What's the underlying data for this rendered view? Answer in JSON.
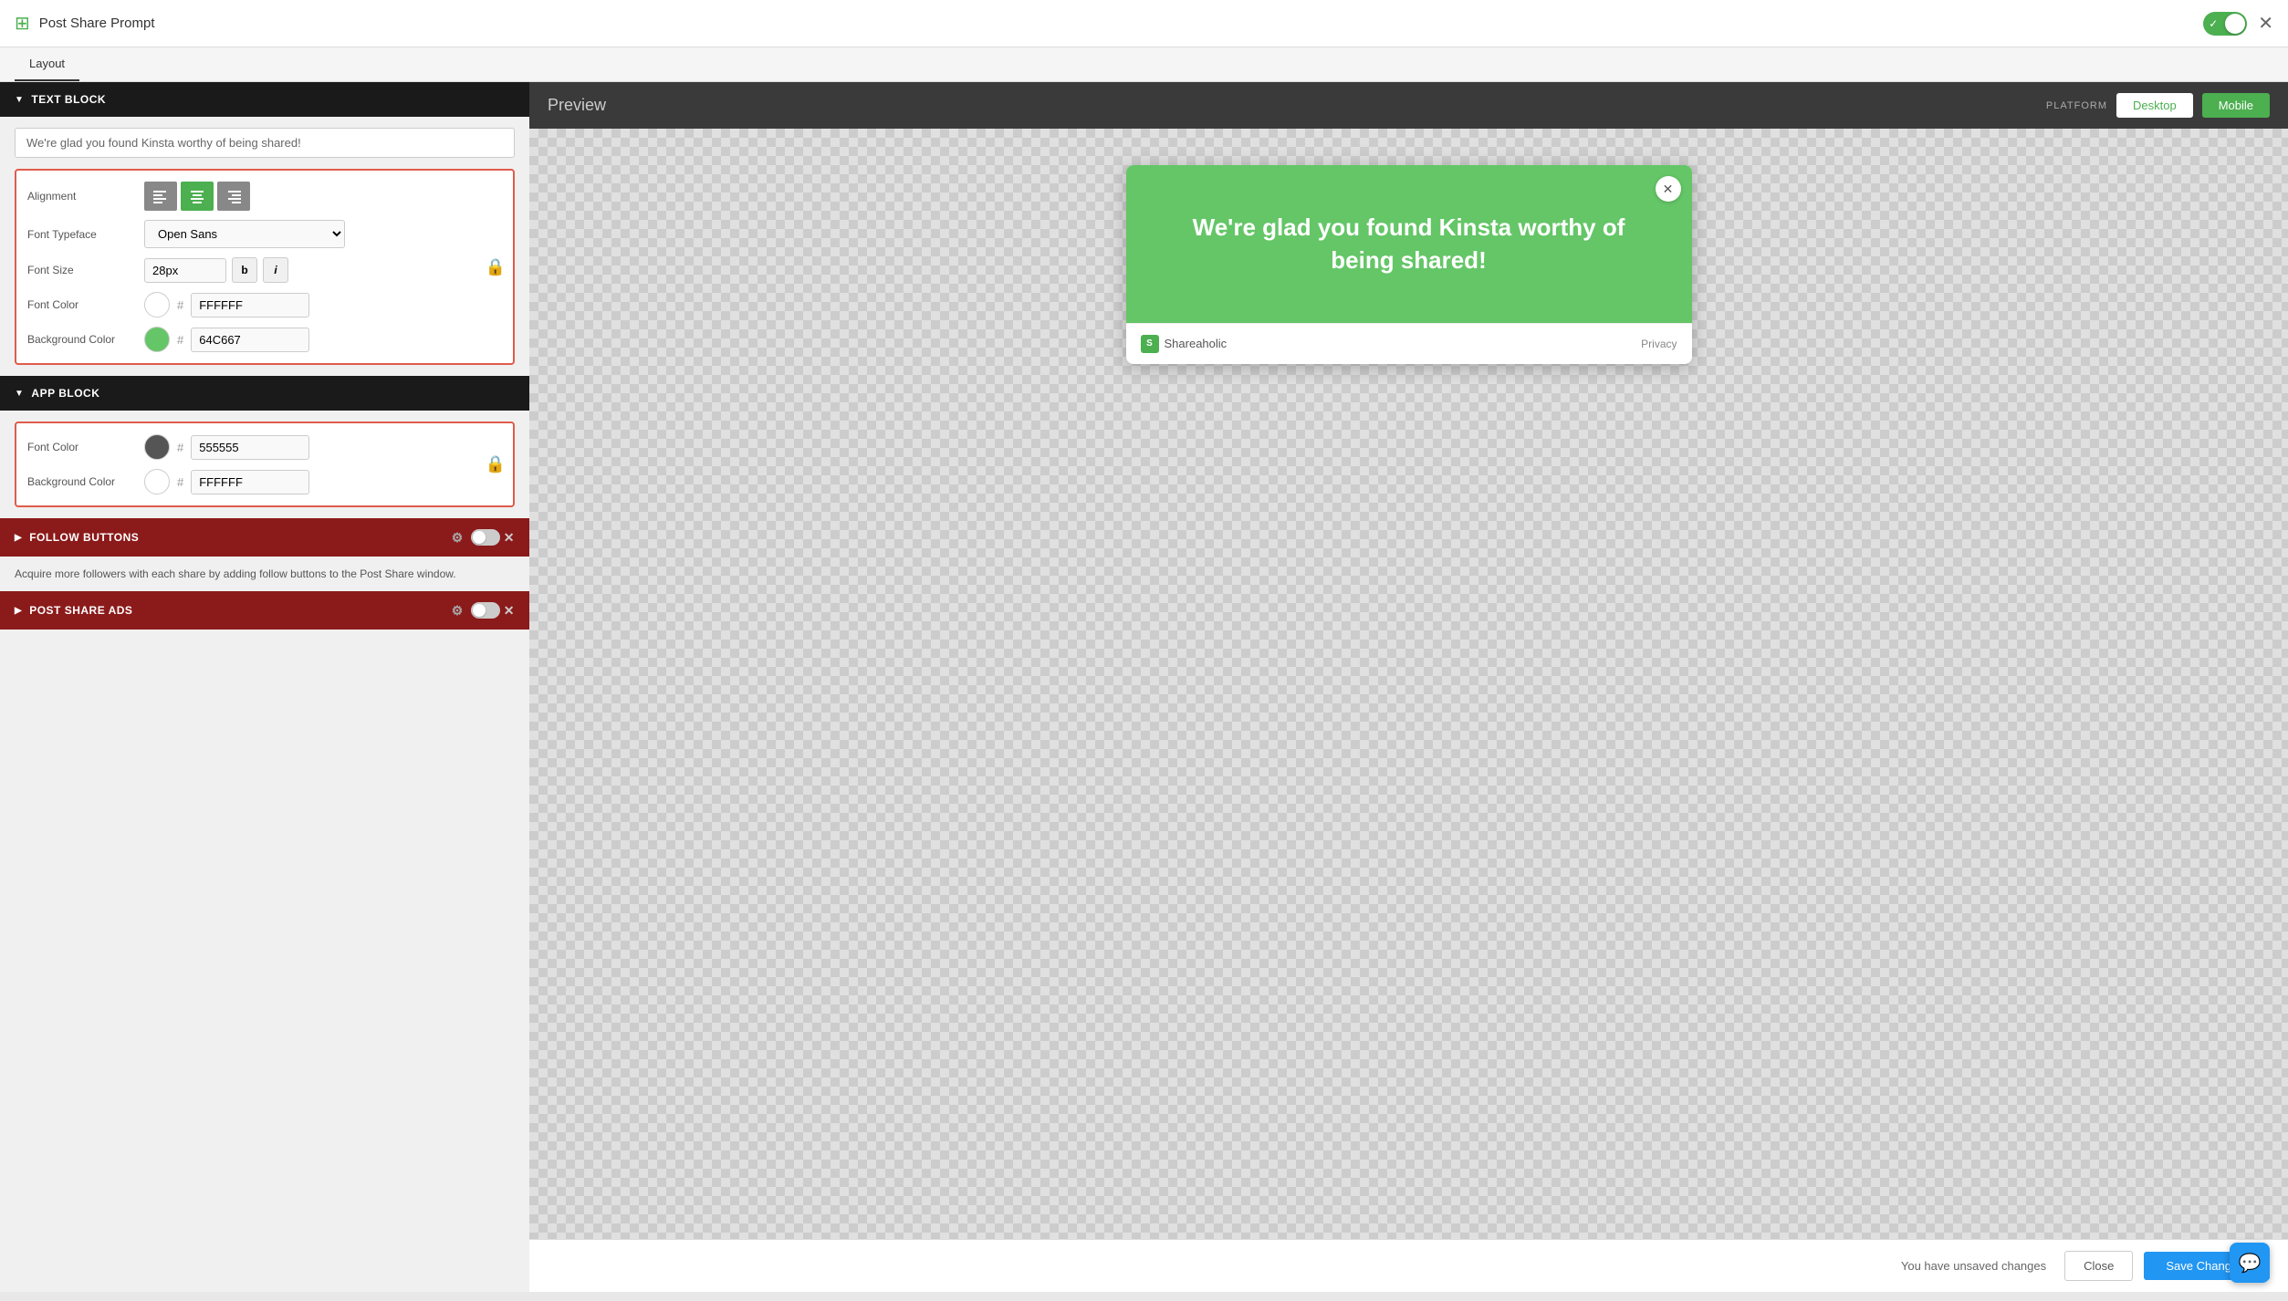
{
  "topbar": {
    "title": "Post Share Prompt",
    "icon": "⊞",
    "toggle_state": true
  },
  "tabs": {
    "layout": "Layout"
  },
  "text_block": {
    "header": "TEXT BLOCK",
    "text_value": "We're glad you found Kinsta worthy of being shared!",
    "alignment": {
      "options": [
        "left",
        "center",
        "right"
      ],
      "active": "center"
    },
    "font_typeface": {
      "label": "Font Typeface",
      "value": "Open Sans"
    },
    "font_size": {
      "label": "Font Size",
      "value": "28px"
    },
    "font_color": {
      "label": "Font Color",
      "value": "FFFFFF",
      "swatch": "#FFFFFF"
    },
    "background_color": {
      "label": "Background Color",
      "value": "64C667",
      "swatch": "#64C667"
    }
  },
  "app_block": {
    "header": "APP BLOCK",
    "font_color": {
      "label": "Font Color",
      "value": "555555",
      "swatch": "#555555"
    },
    "background_color": {
      "label": "Background Color",
      "value": "FFFFFF",
      "swatch": "#FFFFFF"
    }
  },
  "follow_buttons": {
    "header": "FOLLOW BUTTONS",
    "description": "Acquire more followers with each share by adding follow buttons to the Post Share window."
  },
  "post_share_ads": {
    "header": "POST SHARE ADS"
  },
  "preview": {
    "title": "Preview",
    "platform_label": "PLATFORM",
    "desktop_label": "Desktop",
    "mobile_label": "Mobile"
  },
  "card": {
    "text": "We're glad you found Kinsta worthy of being shared!",
    "brand": "Shareaholic",
    "privacy": "Privacy",
    "bg_color": "#64C667"
  },
  "bottom_bar": {
    "unsaved_text": "You have unsaved changes",
    "close_label": "Close",
    "save_label": "Save Change..."
  }
}
